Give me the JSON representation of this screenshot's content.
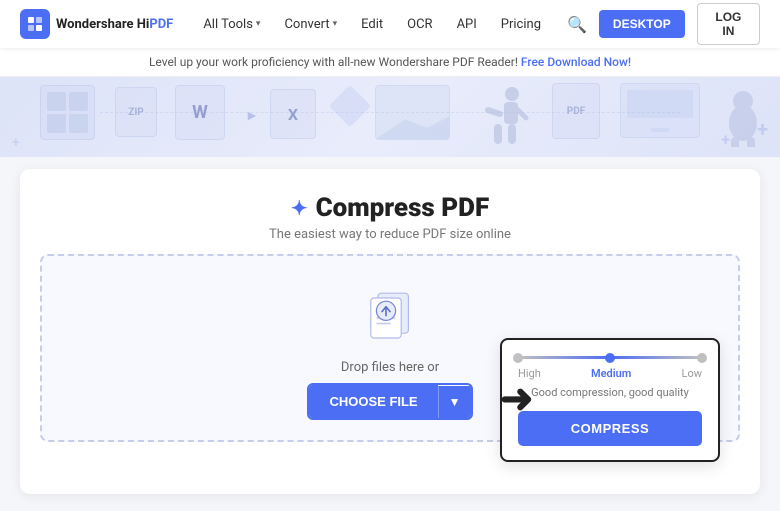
{
  "brand": {
    "logo_text_main": "Wondershare Hi",
    "logo_text_accent": "PDF"
  },
  "navbar": {
    "all_tools_label": "All Tools",
    "convert_label": "Convert",
    "edit_label": "Edit",
    "ocr_label": "OCR",
    "api_label": "API",
    "pricing_label": "Pricing",
    "desktop_btn": "DESKTOP",
    "login_btn": "LOG IN"
  },
  "promo": {
    "text": "Level up your work proficiency with all-new Wondershare PDF Reader!",
    "link_text": "Free Download Now!"
  },
  "page": {
    "title": "Compress PDF",
    "subtitle": "The easiest way to reduce PDF size online"
  },
  "dropzone": {
    "drop_text": "Drop files here or",
    "choose_btn": "CHOOSE FILE"
  },
  "compress_panel": {
    "label_high": "High",
    "label_medium": "Medium",
    "label_low": "Low",
    "quality_desc": "Good compression, good quality",
    "compress_btn": "COMPRESS"
  }
}
